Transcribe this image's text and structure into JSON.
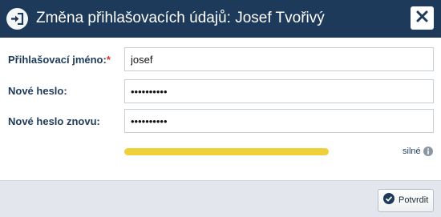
{
  "dialog": {
    "title": "Změna přihlašovacích údajů: Josef Tvořivý",
    "header_icon": "login-arrow-icon",
    "close_icon": "close-icon"
  },
  "form": {
    "username": {
      "label": "Přihlašovací jméno:",
      "required_mark": "*",
      "value": "josef"
    },
    "new_password": {
      "label": "Nové heslo:",
      "value": "••••••••••"
    },
    "new_password_repeat": {
      "label": "Nové heslo znovu:",
      "value": "••••••••••"
    },
    "strength": {
      "label": "silné",
      "level": 1.0,
      "color": "#f0d03a",
      "info_icon": "info-icon"
    }
  },
  "footer": {
    "confirm_label": "Potvrdit",
    "confirm_icon": "check-circle-icon"
  },
  "colors": {
    "header_bg": "#1e3a5a",
    "label": "#1e3a5a",
    "required": "#d9322b",
    "footer_bg": "#e3e6ec"
  }
}
